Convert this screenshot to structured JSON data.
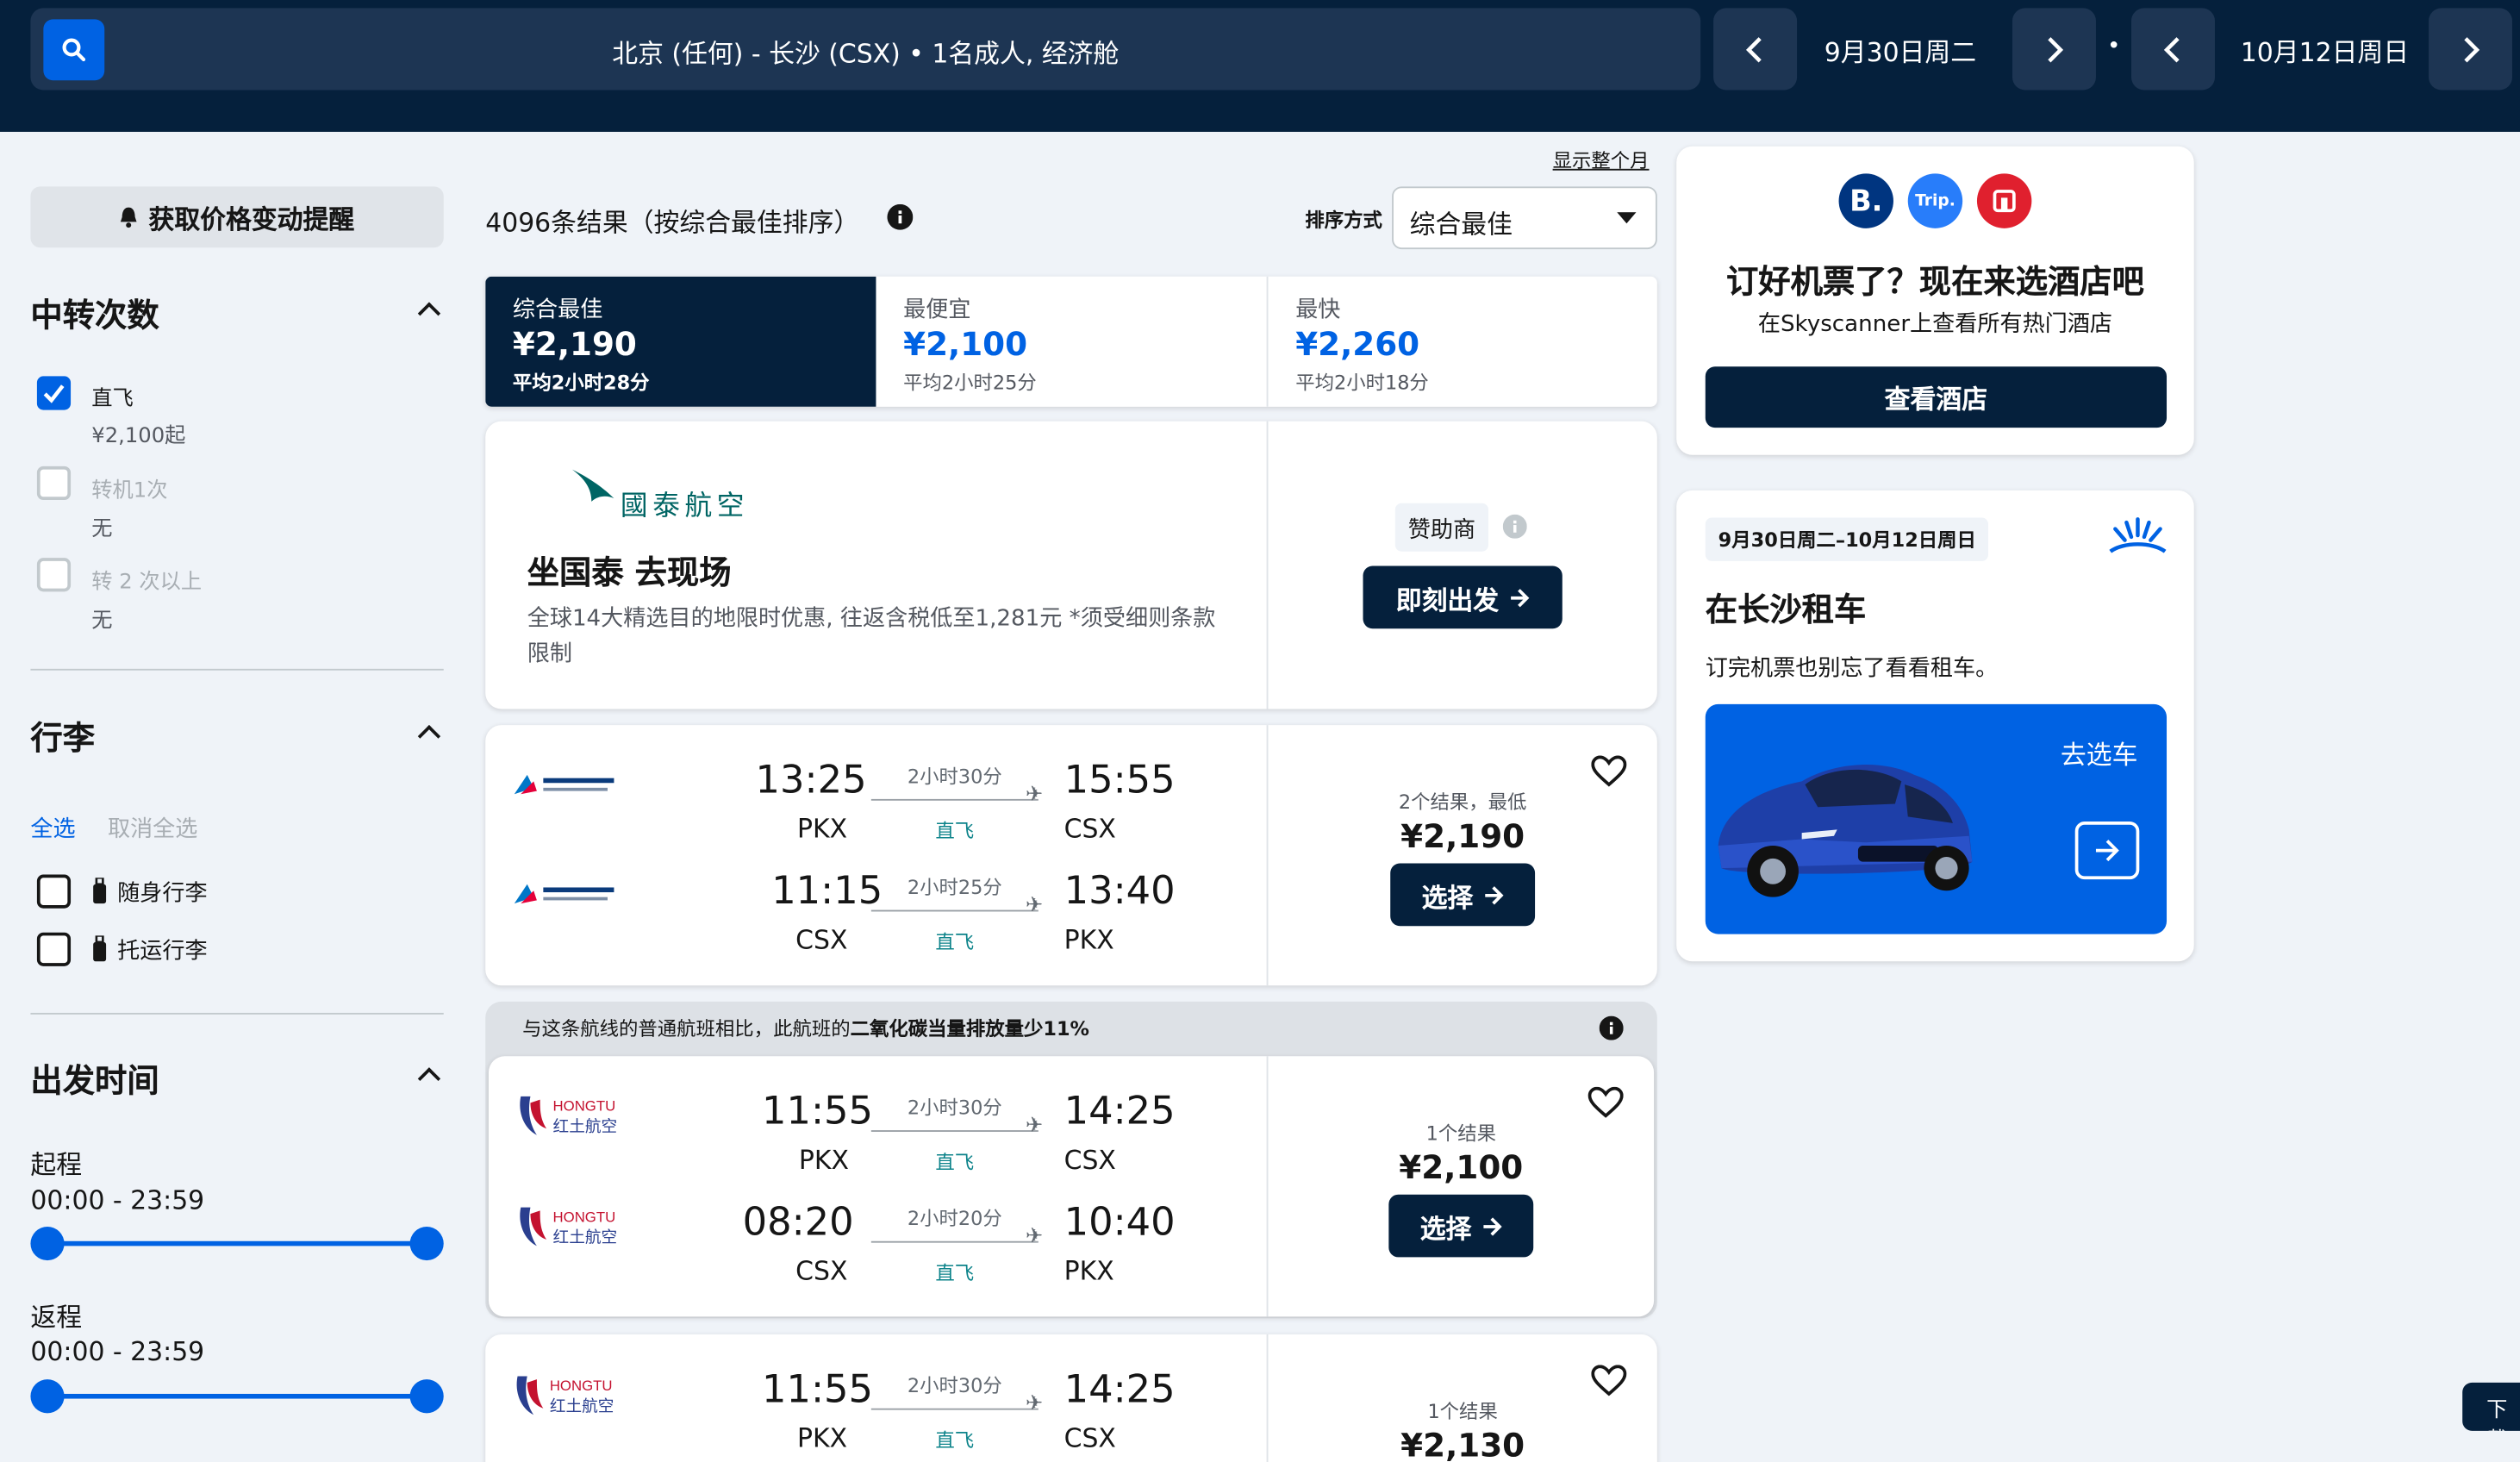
{
  "header": {
    "summary": "北京 (任何) - 长沙 (CSX) • 1名成人, 经济舱",
    "depart_date": "9月30日周二",
    "return_date": "10月12日周日",
    "sep": "•"
  },
  "sidebar": {
    "alert_label": "获取价格变动提醒",
    "stops": {
      "title": "中转次数",
      "options": [
        {
          "label": "直飞",
          "sub": "¥2,100起",
          "checked": true
        },
        {
          "label": "转机1次",
          "sub": "无",
          "checked": false
        },
        {
          "label": "转 2 次以上",
          "sub": "无",
          "checked": false
        }
      ]
    },
    "bags": {
      "title": "行李",
      "select_all": "全选",
      "deselect_all": "取消全选",
      "options": [
        {
          "label": "随身行李"
        },
        {
          "label": "托运行李"
        }
      ]
    },
    "times": {
      "title": "出发时间",
      "outbound_label": "起程",
      "outbound_range": "00:00 - 23:59",
      "outbound_fraction": [
        0.0,
        1.0
      ],
      "return_label": "返程",
      "return_range": "00:00 - 23:59",
      "return_fraction": [
        0.0,
        1.0
      ]
    }
  },
  "results": {
    "count_text": "4096条结果（按综合最佳排序）",
    "show_month": "显示整个月",
    "sort_label": "排序方式",
    "sort_value": "综合最佳",
    "tabs": [
      {
        "label": "综合最佳",
        "price": "¥2,190",
        "avg": "平均2小时28分"
      },
      {
        "label": "最便宜",
        "price": "¥2,100",
        "avg": "平均2小时25分"
      },
      {
        "label": "最快",
        "price": "¥2,260",
        "avg": "平均2小时18分"
      }
    ],
    "ad": {
      "brand": "國泰航空",
      "title": "坐国泰 去现场",
      "desc": "全球14大精选目的地限时优惠, 往返含税低至1,281元 *须受细则条款限制",
      "sponsor": "赞助商",
      "cta": "即刻出发"
    },
    "eco_note_prefix": "与这条航线的普通航班相比，此航班的",
    "eco_note_bold": "二氧化碳当量排放量少11%",
    "flights": [
      {
        "airline": "China Southern Airlines",
        "legs": [
          {
            "dep": "13:25",
            "dep_code": "PKX",
            "dur": "2小时30分",
            "stops": "直飞",
            "arr": "15:55",
            "arr_code": "CSX"
          },
          {
            "dep": "11:15",
            "dep_code": "CSX",
            "dur": "2小时25分",
            "stops": "直飞",
            "arr": "13:40",
            "arr_code": "PKX"
          }
        ],
        "result_note": "2个结果，最低",
        "price": "¥2,190",
        "cta": "选择"
      },
      {
        "airline": "HONGTU",
        "legs": [
          {
            "dep": "11:55",
            "dep_code": "PKX",
            "dur": "2小时30分",
            "stops": "直飞",
            "arr": "14:25",
            "arr_code": "CSX"
          },
          {
            "dep": "08:20",
            "dep_code": "CSX",
            "dur": "2小时20分",
            "stops": "直飞",
            "arr": "10:40",
            "arr_code": "PKX"
          }
        ],
        "result_note": "1个结果",
        "price": "¥2,100",
        "cta": "选择"
      },
      {
        "airline": "HONGTU",
        "legs": [
          {
            "dep": "11:55",
            "dep_code": "PKX",
            "dur": "2小时30分",
            "stops": "直飞",
            "arr": "14:25",
            "arr_code": "CSX"
          }
        ],
        "result_note": "1个结果",
        "price": "¥2,130"
      }
    ]
  },
  "right": {
    "hotel": {
      "title": "订好机票了？现在来选酒店吧",
      "sub": "在Skyscanner上查看所有热门酒店",
      "cta": "查看酒店",
      "logo_b": "B.",
      "logo_trip": "Trip."
    },
    "car": {
      "dates": "9月30日周二–10月12日周日",
      "title": "在长沙租车",
      "sub": "订完机票也别忘了看看租车。",
      "cta": "去选车"
    }
  },
  "corner_tab": "下载"
}
